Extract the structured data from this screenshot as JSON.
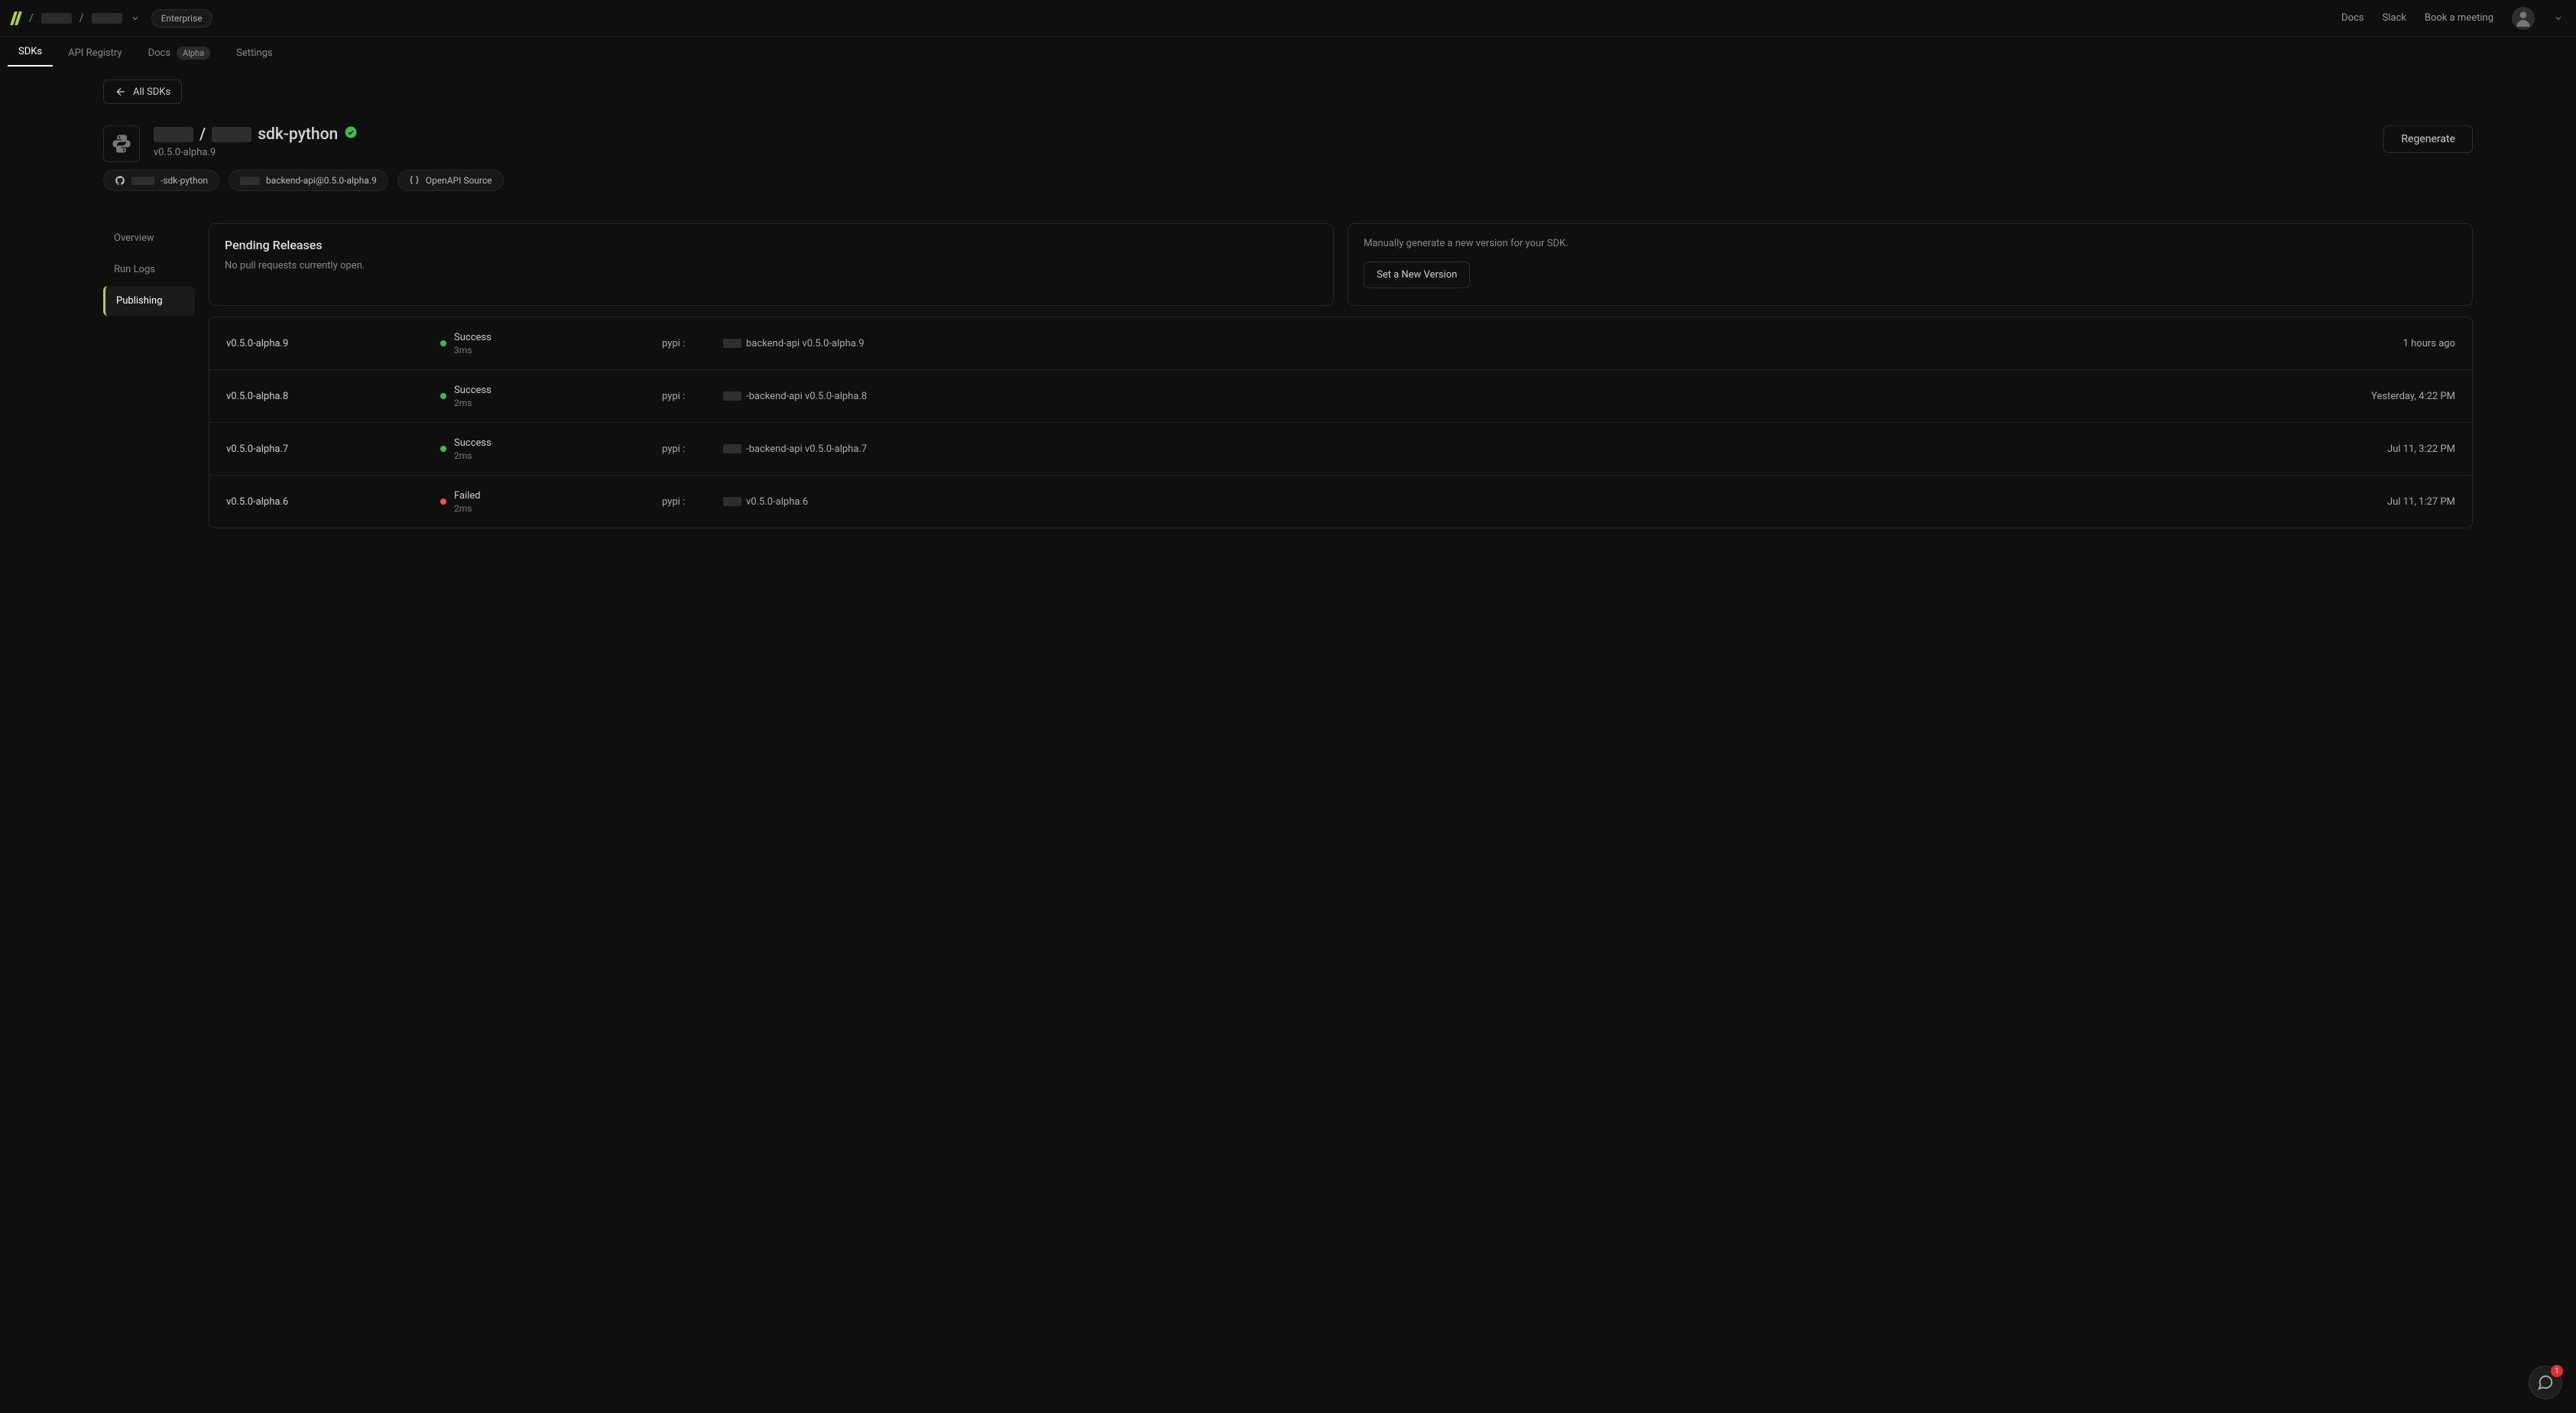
{
  "topbar": {
    "enterprise_badge": "Enterprise",
    "links": {
      "docs": "Docs",
      "slack": "Slack",
      "book": "Book a meeting"
    }
  },
  "tabs": {
    "sdks": "SDKs",
    "api_registry": "API Registry",
    "docs": "Docs",
    "alpha_badge": "Alpha",
    "settings": "Settings"
  },
  "back_button": "All SDKs",
  "sdk": {
    "title_suffix": "sdk-python",
    "version": "v0.5.0-alpha.9",
    "regenerate": "Regenerate"
  },
  "pills": {
    "github_suffix": "-sdk-python",
    "backend_prefix": "",
    "backend_suffix": "backend-api@0.5.0-alpha.9",
    "openapi": "OpenAPI Source"
  },
  "sidenav": {
    "overview": "Overview",
    "run_logs": "Run Logs",
    "publishing": "Publishing"
  },
  "pending_card": {
    "title": "Pending Releases",
    "empty": "No pull requests currently open."
  },
  "manual_card": {
    "text": "Manually generate a new version for your SDK.",
    "button": "Set a New Version"
  },
  "releases": [
    {
      "version": "v0.5.0-alpha.9",
      "status": "Success",
      "status_kind": "success",
      "duration": "3ms",
      "registry": "pypi :",
      "package": "backend-api v0.5.0-alpha.9",
      "time": "1 hours ago"
    },
    {
      "version": "v0.5.0-alpha.8",
      "status": "Success",
      "status_kind": "success",
      "duration": "2ms",
      "registry": "pypi :",
      "package": "-backend-api v0.5.0-alpha.8",
      "time": "Yesterday, 4:22 PM"
    },
    {
      "version": "v0.5.0-alpha.7",
      "status": "Success",
      "status_kind": "success",
      "duration": "2ms",
      "registry": "pypi :",
      "package": "-backend-api v0.5.0-alpha.7",
      "time": "Jul 11, 3:22 PM"
    },
    {
      "version": "v0.5.0-alpha.6",
      "status": "Failed",
      "status_kind": "failed",
      "duration": "2ms",
      "registry": "pypi :",
      "package": "v0.5.0-alpha.6",
      "time": "Jul 11, 1:27 PM"
    }
  ],
  "chat_badge": "1"
}
